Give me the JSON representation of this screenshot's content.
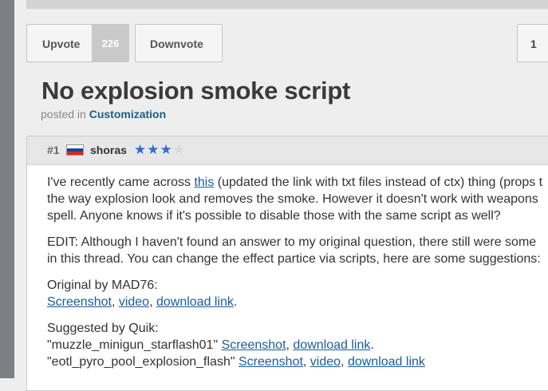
{
  "votes": {
    "upvote_label": "Upvote",
    "upvote_count": "226",
    "downvote_label": "Downvote",
    "page_number": "1"
  },
  "topic": {
    "title": "No explosion smoke script",
    "posted_in": "posted in",
    "category": "Customization"
  },
  "post": {
    "number": "#1",
    "author": "shoras",
    "flag": "russia-flag",
    "rating": {
      "filled": 3,
      "empty": 1
    },
    "colors": {
      "star_on": "#2f6fc9",
      "star_off": "#d8d8d8",
      "link": "#1a5c9a",
      "category": "#1f5f86"
    },
    "p1": {
      "l1_a": "I've recently came across ",
      "l1_link": "this",
      "l1_b": " (updated the link with txt files instead of ctx) thing (props t",
      "l2": "the way explosion look and removes the smoke. However it doesn't work with weapons",
      "l3": "spell. Anyone knows if it's possible to disable those with the same script as well?"
    },
    "p2": {
      "l1": "EDIT: Although I haven't found an answer to my original question, there still were some",
      "l2": "in this thread. You can change the effect partice via scripts, here are some suggestions:"
    },
    "p3": {
      "heading": "Original by MAD76:",
      "link1": "Screenshot",
      "link2": "video",
      "link3": "download link",
      "sep": ", ",
      "end": "."
    },
    "p4": {
      "heading": "Suggested by Quik:",
      "line1_text": "\"muzzle_minigun_starflash01\" ",
      "line1_link1": "Screenshot",
      "line1_link2": "download link",
      "line2_text": "\"eotl_pyro_pool_explosion_flash\" ",
      "line2_link1": "Screenshot",
      "line2_link2": "video",
      "line2_link3": "download link"
    }
  }
}
